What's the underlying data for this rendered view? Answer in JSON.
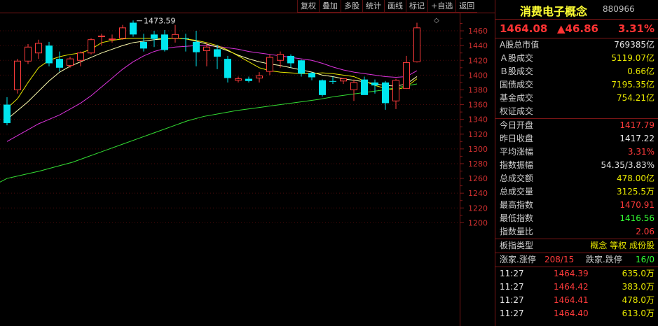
{
  "toolbar": [
    "复权",
    "叠加",
    "多股",
    "统计",
    "画线",
    "标记",
    "+自选",
    "返回"
  ],
  "chart_data": {
    "type": "candlestick",
    "ylim": [
      1195,
      1480
    ],
    "y_ticks": [
      1460,
      1440,
      1420,
      1400,
      1380,
      1360,
      1340,
      1320,
      1300,
      1280,
      1260,
      1240,
      1220,
      1200
    ],
    "high_label": "1473.59",
    "candles": [
      {
        "o": 1360,
        "h": 1370,
        "l": 1332,
        "c": 1335
      },
      {
        "o": 1380,
        "h": 1422,
        "l": 1375,
        "c": 1419
      },
      {
        "o": 1419,
        "h": 1442,
        "l": 1415,
        "c": 1438
      },
      {
        "o": 1430,
        "h": 1448,
        "l": 1422,
        "c": 1443
      },
      {
        "o": 1440,
        "h": 1445,
        "l": 1412,
        "c": 1416
      },
      {
        "o": 1422,
        "h": 1432,
        "l": 1405,
        "c": 1410
      },
      {
        "o": 1413,
        "h": 1425,
        "l": 1410,
        "c": 1422
      },
      {
        "o": 1420,
        "h": 1432,
        "l": 1412,
        "c": 1430
      },
      {
        "o": 1430,
        "h": 1450,
        "l": 1428,
        "c": 1448
      },
      {
        "o": 1452,
        "h": 1456,
        "l": 1440,
        "c": 1453
      },
      {
        "o": 1449,
        "h": 1455,
        "l": 1444,
        "c": 1449
      },
      {
        "o": 1450,
        "h": 1468,
        "l": 1448,
        "c": 1464
      },
      {
        "o": 1471,
        "h": 1474,
        "l": 1452,
        "c": 1455
      },
      {
        "o": 1445,
        "h": 1456,
        "l": 1432,
        "c": 1436
      },
      {
        "o": 1455,
        "h": 1460,
        "l": 1438,
        "c": 1449
      },
      {
        "o": 1455,
        "h": 1461,
        "l": 1432,
        "c": 1434
      },
      {
        "o": 1450,
        "h": 1468,
        "l": 1444,
        "c": 1455
      },
      {
        "o": 1450,
        "h": 1456,
        "l": 1432,
        "c": 1449
      },
      {
        "o": 1445,
        "h": 1460,
        "l": 1412,
        "c": 1431
      },
      {
        "o": 1433,
        "h": 1444,
        "l": 1412,
        "c": 1438
      },
      {
        "o": 1435,
        "h": 1441,
        "l": 1408,
        "c": 1425
      },
      {
        "o": 1422,
        "h": 1426,
        "l": 1390,
        "c": 1396
      },
      {
        "o": 1393,
        "h": 1398,
        "l": 1390,
        "c": 1395
      },
      {
        "o": 1395,
        "h": 1398,
        "l": 1390,
        "c": 1392
      },
      {
        "o": 1396,
        "h": 1404,
        "l": 1390,
        "c": 1399
      },
      {
        "o": 1405,
        "h": 1428,
        "l": 1400,
        "c": 1424
      },
      {
        "o": 1420,
        "h": 1432,
        "l": 1410,
        "c": 1428
      },
      {
        "o": 1426,
        "h": 1428,
        "l": 1410,
        "c": 1416
      },
      {
        "o": 1420,
        "h": 1421,
        "l": 1398,
        "c": 1402
      },
      {
        "o": 1403,
        "h": 1404,
        "l": 1393,
        "c": 1397
      },
      {
        "o": 1393,
        "h": 1394,
        "l": 1371,
        "c": 1373
      },
      {
        "o": 1392,
        "h": 1398,
        "l": 1388,
        "c": 1391
      },
      {
        "o": 1392,
        "h": 1396,
        "l": 1388,
        "c": 1395
      },
      {
        "o": 1380,
        "h": 1394,
        "l": 1365,
        "c": 1390
      },
      {
        "o": 1394,
        "h": 1398,
        "l": 1375,
        "c": 1373
      },
      {
        "o": 1390,
        "h": 1394,
        "l": 1375,
        "c": 1386
      },
      {
        "o": 1390,
        "h": 1392,
        "l": 1353,
        "c": 1362
      },
      {
        "o": 1365,
        "h": 1395,
        "l": 1354,
        "c": 1393
      },
      {
        "o": 1382,
        "h": 1426,
        "l": 1382,
        "c": 1417
      },
      {
        "o": 1418,
        "h": 1471,
        "l": 1417,
        "c": 1464
      }
    ],
    "ma_yellow": [
      1355,
      1368,
      1390,
      1410,
      1420,
      1425,
      1428,
      1430,
      1435,
      1444,
      1447,
      1449,
      1450,
      1450,
      1450,
      1449,
      1450,
      1449,
      1447,
      1444,
      1440,
      1434,
      1426,
      1418,
      1410,
      1406,
      1404,
      1403,
      1402,
      1402,
      1403,
      1402,
      1400,
      1398,
      1392,
      1386,
      1382,
      1380,
      1384,
      1395
    ],
    "ma_white": [
      1340,
      1352,
      1364,
      1378,
      1392,
      1404,
      1412,
      1418,
      1424,
      1430,
      1435,
      1440,
      1444,
      1446,
      1448,
      1449,
      1450,
      1449,
      1446,
      1442,
      1438,
      1433,
      1427,
      1422,
      1418,
      1415,
      1413,
      1410,
      1407,
      1404,
      1400,
      1398,
      1395,
      1393,
      1391,
      1388,
      1386,
      1385,
      1388,
      1398
    ],
    "ma_magenta": [
      1310,
      1318,
      1326,
      1334,
      1340,
      1346,
      1354,
      1362,
      1372,
      1384,
      1396,
      1408,
      1418,
      1426,
      1432,
      1436,
      1438,
      1439,
      1440,
      1440,
      1439,
      1437,
      1435,
      1432,
      1430,
      1428,
      1426,
      1424,
      1422,
      1420,
      1416,
      1411,
      1407,
      1404,
      1402,
      1400,
      1398,
      1397,
      1398,
      1406
    ],
    "ma_green": [
      1260,
      1265,
      1270,
      1276,
      1282,
      1290,
      1298,
      1306,
      1314,
      1322,
      1330,
      1338,
      1344,
      1348,
      1352,
      1355,
      1358,
      1361,
      1364,
      1367,
      1371,
      1374,
      1377,
      1380,
      1384,
      1388
    ]
  },
  "panel": {
    "name": "消费电子概念",
    "code": "880966",
    "price": "1464.08",
    "change": "▲46.86",
    "pct": "3.31%",
    "rows1": [
      {
        "label": "A股总市值",
        "value": "769385亿",
        "cls": "white"
      },
      {
        "label": "Ａ股成交",
        "value": "5119.07亿",
        "cls": "yellow"
      },
      {
        "label": "Ｂ股成交",
        "value": "0.66亿",
        "cls": "yellow"
      },
      {
        "label": "国债成交",
        "value": "7195.35亿",
        "cls": "yellow"
      },
      {
        "label": "基金成交",
        "value": "754.21亿",
        "cls": "yellow"
      },
      {
        "label": "权证成交",
        "value": "",
        "cls": "yellow"
      }
    ],
    "rows2": [
      {
        "label": "今日开盘",
        "value": "1417.79",
        "cls": "red"
      },
      {
        "label": "昨日收盘",
        "value": "1417.22",
        "cls": "white"
      },
      {
        "label": "平均涨幅",
        "value": "3.31%",
        "cls": "red"
      },
      {
        "label": "指数振幅",
        "value": "54.35/3.83%",
        "cls": "white"
      },
      {
        "label": "总成交额",
        "value": "478.00亿",
        "cls": "yellow"
      },
      {
        "label": "总成交量",
        "value": "3125.5万",
        "cls": "yellow"
      },
      {
        "label": "最高指数",
        "value": "1470.91",
        "cls": "red"
      },
      {
        "label": "最低指数",
        "value": "1416.56",
        "cls": "green"
      },
      {
        "label": "指数量比",
        "value": "2.06",
        "cls": "red"
      }
    ],
    "type_label": "板指类型",
    "type_value": "概念 等权 成份股",
    "up_label": "涨家.涨停",
    "up_value": "208/15",
    "down_label": "跌家.跌停",
    "down_value": "16/0",
    "ticks": [
      {
        "t": "11:27",
        "p": "1464.39",
        "v": "635.0万"
      },
      {
        "t": "11:27",
        "p": "1464.42",
        "v": "383.0万"
      },
      {
        "t": "11:27",
        "p": "1464.41",
        "v": "478.0万"
      },
      {
        "t": "11:27",
        "p": "1464.40",
        "v": "613.0万"
      }
    ],
    "colors": {
      "up": "#ff3b3b",
      "down": "#00e5ee",
      "border": "#7a1616"
    }
  }
}
